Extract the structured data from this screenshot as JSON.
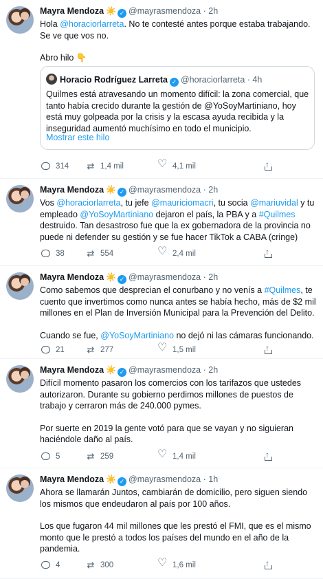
{
  "tweets": [
    {
      "name": "Mayra Mendoza",
      "emoji": "☀️",
      "handle": "@mayrasmendoza",
      "time": "2h",
      "paragraphs": [
        [
          {
            "t": "Hola "
          },
          {
            "t": "@horaciorlarreta",
            "link": true
          },
          {
            "t": ". No te contesté antes porque estaba trabajando. Se ve que vos no."
          }
        ],
        [
          {
            "t": "Abro hilo 👇"
          }
        ]
      ],
      "quote": {
        "name": "Horacio Rodríguez Larreta",
        "handle": "@horaciorlarreta",
        "time": "4h",
        "text": "Quilmes está atravesando un momento difícil: la zona comercial, que tanto había crecido durante la gestión de @YoSoyMartiniano, hoy está muy golpeada por la crisis y la escasa ayuda recibida y la inseguridad aumentó muchísimo en todo el municipio.",
        "show_thread": "Mostrar este hilo"
      },
      "replies": "314",
      "retweets": "1,4 mil",
      "likes": "4,1 mil"
    },
    {
      "name": "Mayra Mendoza",
      "emoji": "☀️",
      "handle": "@mayrasmendoza",
      "time": "2h",
      "paragraphs": [
        [
          {
            "t": "Vos "
          },
          {
            "t": "@horaciorlarreta",
            "link": true
          },
          {
            "t": ", tu jefe "
          },
          {
            "t": "@mauriciomacri",
            "link": true
          },
          {
            "t": ", tu socia "
          },
          {
            "t": "@mariuvidal",
            "link": true
          },
          {
            "t": " y tu empleado "
          },
          {
            "t": "@YoSoyMartiniano",
            "link": true
          },
          {
            "t": " dejaron el país, la PBA y a "
          },
          {
            "t": "#Quilmes",
            "link": true
          },
          {
            "t": " destruido. Tan desastroso fue que la ex gobernadora de la provincia no puede ni defender su gestión y se fue hacer TikTok a CABA (cringe)"
          }
        ]
      ],
      "replies": "38",
      "retweets": "554",
      "likes": "2,4 mil"
    },
    {
      "name": "Mayra Mendoza",
      "emoji": "☀️",
      "handle": "@mayrasmendoza",
      "time": "2h",
      "paragraphs": [
        [
          {
            "t": "Como sabemos que desprecian el conurbano y no venís a "
          },
          {
            "t": "#Quilmes",
            "link": true
          },
          {
            "t": ", te cuento que invertimos como nunca antes se había hecho, más de $2 mil millones en el Plan de Inversión Municipal para la Prevención del Delito."
          }
        ],
        [
          {
            "t": "Cuando se fue, "
          },
          {
            "t": "@YoSoyMartiniano",
            "link": true
          },
          {
            "t": " no dejó ni las cámaras funcionando."
          }
        ]
      ],
      "replies": "21",
      "retweets": "277",
      "likes": "1,5 mil"
    },
    {
      "name": "Mayra Mendoza",
      "emoji": "☀️",
      "handle": "@mayrasmendoza",
      "time": "2h",
      "paragraphs": [
        [
          {
            "t": "Difícil momento pasaron los comercios con los tarifazos que ustedes autorizaron. Durante su gobierno perdimos millones de puestos de trabajo y cerraron más de 240.000 pymes."
          }
        ],
        [
          {
            "t": "Por suerte en 2019 la gente votó para que se vayan y no siguieran haciéndole daño al país."
          }
        ]
      ],
      "replies": "5",
      "retweets": "259",
      "likes": "1,4 mil"
    },
    {
      "name": "Mayra Mendoza",
      "emoji": "☀️",
      "handle": "@mayrasmendoza",
      "time": "1h",
      "paragraphs": [
        [
          {
            "t": "Ahora se llamarán Juntos, cambiarán de domicilio, pero siguen siendo los mismos que endeudaron al país por 100 años."
          }
        ],
        [
          {
            "t": "Los que fugaron 44 mil millones que les prestó el FMI, que es el mismo monto que le prestó a todos los países del mundo en el año de la pandemia."
          }
        ]
      ],
      "replies": "4",
      "retweets": "300",
      "likes": "1,6 mil"
    }
  ],
  "icons": {
    "reply": "reply-bubble-icon",
    "retweet": "retweet-icon",
    "like": "heart-icon",
    "share": "share-icon",
    "verified": "verified-badge-icon"
  },
  "colors": {
    "link": "#1d9bf0",
    "secondary_text": "#536471",
    "verified": "#1d9bf0"
  }
}
